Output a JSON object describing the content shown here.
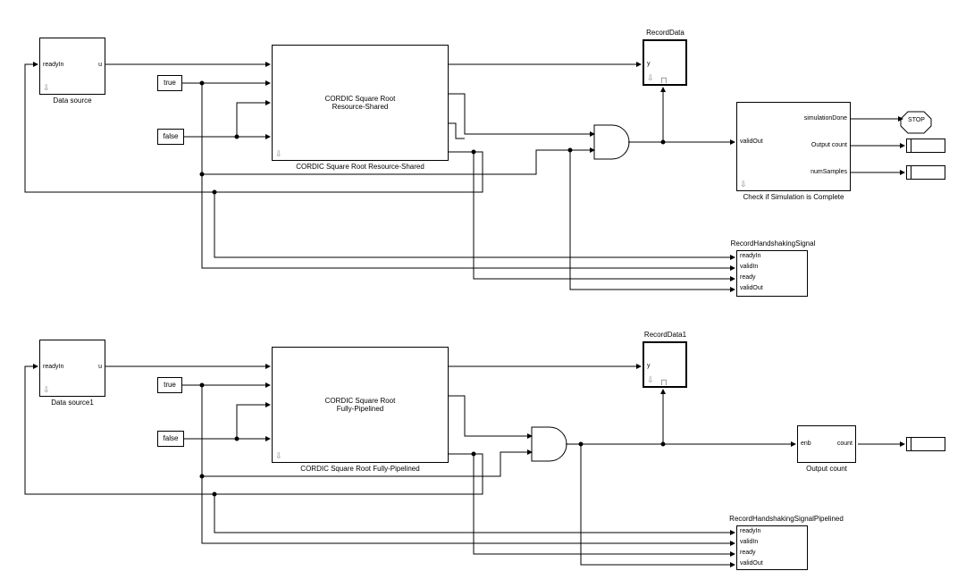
{
  "top": {
    "dataSource": {
      "label": "Data source",
      "ports": {
        "readyIn": "readyIn",
        "u": "u"
      }
    },
    "const1": {
      "label": "true"
    },
    "const2": {
      "label": "false"
    },
    "cordic": {
      "line1": "CORDIC Square Root",
      "line2": "Resource-Shared",
      "label": "CORDIC Square Root Resource-Shared"
    },
    "recordData": {
      "label": "RecordData",
      "port": "y"
    },
    "check": {
      "label": "Check if Simulation is Complete",
      "ports": {
        "simDone": "simulationDone",
        "validOut": "validOut",
        "outCount": "Output count",
        "numSamples": "numSamples"
      }
    },
    "hshake": {
      "label": "RecordHandshakingSignal",
      "ports": [
        "readyIn",
        "validIn",
        "ready",
        "validOut"
      ]
    },
    "stop": "STOP"
  },
  "bottom": {
    "dataSource": {
      "label": "Data source1",
      "ports": {
        "readyIn": "readyIn",
        "u": "u"
      }
    },
    "const1": {
      "label": "true"
    },
    "const2": {
      "label": "false"
    },
    "cordic": {
      "line1": "CORDIC Square Root",
      "line2": "Fully-Pipelined",
      "label": "CORDIC Square Root Fully-Pipelined"
    },
    "recordData": {
      "label": "RecordData1",
      "port": "y"
    },
    "counter": {
      "label": "Output count",
      "ports": {
        "enb": "enb",
        "count": "count"
      }
    },
    "hshake": {
      "label": "RecordHandshakingSignalPipelined",
      "ports": [
        "readyIn",
        "validIn",
        "ready",
        "validOut"
      ]
    }
  }
}
